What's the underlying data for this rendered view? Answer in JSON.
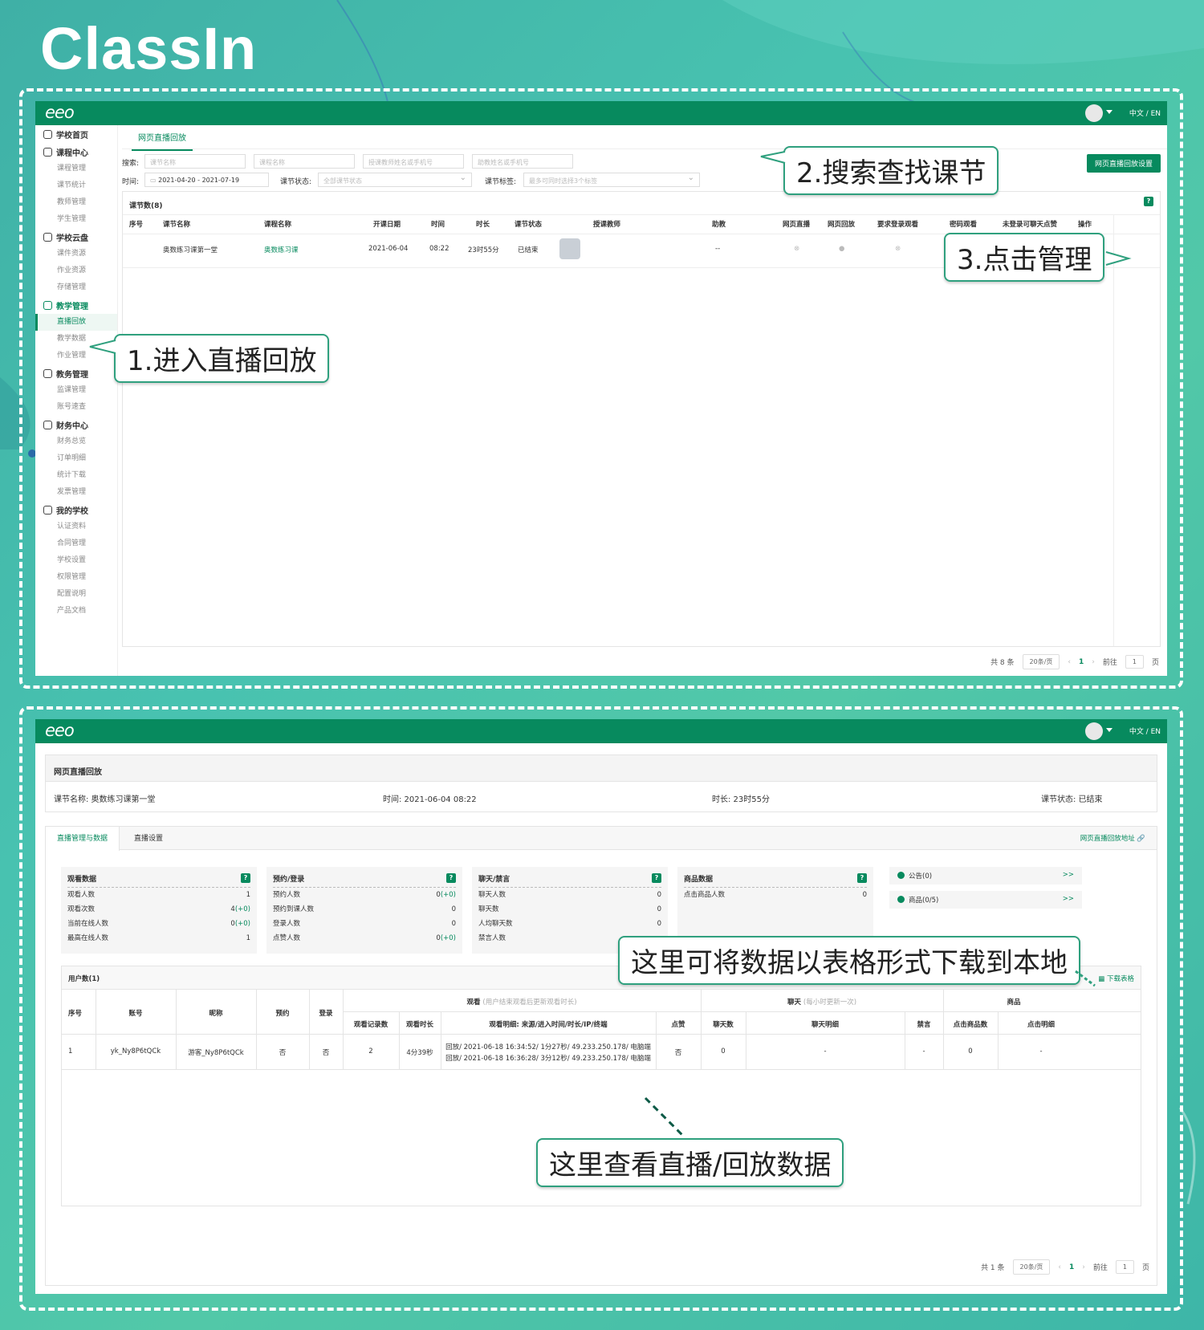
{
  "brand": {
    "logo_text": "ClassIn",
    "app_logo": "eeo"
  },
  "topbar": {
    "lang": "中文 / EN"
  },
  "sidebar": {
    "groups": [
      {
        "label": "学校首页",
        "items": []
      },
      {
        "label": "课程中心",
        "items": [
          "课程管理",
          "课节统计",
          "教师管理",
          "学生管理"
        ]
      },
      {
        "label": "学校云盘",
        "items": [
          "课件资源",
          "作业资源",
          "存储管理"
        ]
      },
      {
        "label": "教学管理",
        "items": [
          "直播回放",
          "教学数据",
          "作业管理"
        ]
      },
      {
        "label": "教务管理",
        "items": [
          "监课管理",
          "账号速查"
        ]
      },
      {
        "label": "财务中心",
        "items": [
          "财务总览",
          "订单明细",
          "统计下载",
          "发票管理"
        ]
      },
      {
        "label": "我的学校",
        "items": [
          "认证资料",
          "合同管理",
          "学校设置",
          "权限管理",
          "配置说明",
          "产品文档"
        ]
      }
    ],
    "active_group": "教学管理",
    "active_item": "直播回放"
  },
  "page1": {
    "tab": "网页直播回放",
    "search_label": "搜索:",
    "search_placeholders": [
      "课节名称",
      "课程名称",
      "授课教师姓名或手机号",
      "助教姓名或手机号"
    ],
    "time_label": "时间:",
    "date_range": "2021-04-20  - 2021-07-19",
    "status_label": "课节状态:",
    "status_placeholder": "全部课节状态",
    "tag_label": "课节标签:",
    "tag_placeholder": "最多可同时选择3个标签",
    "settings_button": "网页直播回放设置",
    "count_label": "课节数(8)",
    "columns": [
      "序号",
      "课节名称",
      "课程名称",
      "开课日期",
      "时间",
      "时长",
      "课节状态",
      "授课教师",
      "助教",
      "网页直播",
      "网页回放",
      "要求登录观看",
      "密码观看",
      "未登录可聊天点赞",
      "操作"
    ],
    "row": {
      "lesson": "奥数练习课第一堂",
      "course": "奥数练习课",
      "date": "2021-06-04",
      "time": "08:22",
      "duration": "23时55分",
      "status": "已结束",
      "assistant": "--",
      "action": "管理"
    },
    "pager": {
      "total": "共 8 条",
      "per_page": "20条/页",
      "page": "1",
      "goto": "前往",
      "goto_val": "1",
      "page_unit": "页"
    }
  },
  "callouts": {
    "c1": "1.进入直播回放",
    "c2": "2.搜索查找课节",
    "c3": "3.点击管理",
    "c4": "这里可将数据以表格形式下载到本地",
    "c5": "这里查看直播/回放数据"
  },
  "page2": {
    "title": "网页直播回放",
    "info": {
      "lesson": "课节名称: 奥数练习课第一堂",
      "time": "时间: 2021-06-04 08:22",
      "duration": "时长: 23时55分",
      "status": "课节状态:  已结束"
    },
    "tabs": [
      "直播管理与数据",
      "直播设置"
    ],
    "replay_link": "网页直播回放地址 🔗",
    "stats": [
      {
        "title": "观看数据",
        "rows": [
          [
            "观看人数",
            "1",
            ""
          ],
          [
            "观看次数",
            "4",
            "(+0)"
          ],
          [
            "当前在线人数",
            "0",
            "(+0)"
          ],
          [
            "最高在线人数",
            "1",
            ""
          ]
        ]
      },
      {
        "title": "预约/登录",
        "rows": [
          [
            "预约人数",
            "0",
            "(+0)"
          ],
          [
            "预约到课人数",
            "0",
            ""
          ],
          [
            "登录人数",
            "0",
            ""
          ],
          [
            "点赞人数",
            "0",
            "(+0)"
          ]
        ]
      },
      {
        "title": "聊天/禁言",
        "rows": [
          [
            "聊天人数",
            "0",
            ""
          ],
          [
            "聊天数",
            "0",
            ""
          ],
          [
            "人均聊天数",
            "0",
            ""
          ],
          [
            "禁言人数",
            "",
            ""
          ]
        ]
      },
      {
        "title": "商品数据",
        "rows": [
          [
            "点击商品人数",
            "0",
            ""
          ]
        ]
      }
    ],
    "side_items": [
      {
        "label": "公告(0)",
        "arrow": ">>"
      },
      {
        "label": "商品(0/5)",
        "arrow": ">>"
      }
    ],
    "users_label": "用户数(1)",
    "download": "下载表格",
    "groups": {
      "watch": "观看",
      "watch_note": "(用户结束观看后更新观看时长)",
      "chat": "聊天",
      "chat_note": "(每小时更新一次)",
      "goods": "商品"
    },
    "cols": [
      "序号",
      "账号",
      "昵称",
      "预约",
      "登录",
      "观看记录数",
      "观看时长",
      "观看明细: 来源/进入时间/时长/IP/终端",
      "点赞",
      "聊天数",
      "聊天明细",
      "禁言",
      "点击商品数",
      "点击明细"
    ],
    "row": {
      "no": "1",
      "account": "yk_Ny8P6tQCk",
      "nick": "游客_Ny8P6tQCk",
      "reserve": "否",
      "login": "否",
      "records": "2",
      "dur": "4分39秒",
      "detail1": "回放/ 2021-06-18 16:34:52/ 1分27秒/ 49.233.250.178/ 电脑端",
      "detail2": "回放/ 2021-06-18 16:36:28/ 3分12秒/ 49.233.250.178/ 电脑端",
      "like": "否",
      "chats": "0",
      "chat_detail": "-",
      "mute": "-",
      "goods_clicks": "0",
      "goods_detail": "-"
    },
    "pager": {
      "total": "共 1 条",
      "per_page": "20条/页",
      "page": "1",
      "goto": "前往",
      "goto_val": "1",
      "page_unit": "页"
    }
  }
}
